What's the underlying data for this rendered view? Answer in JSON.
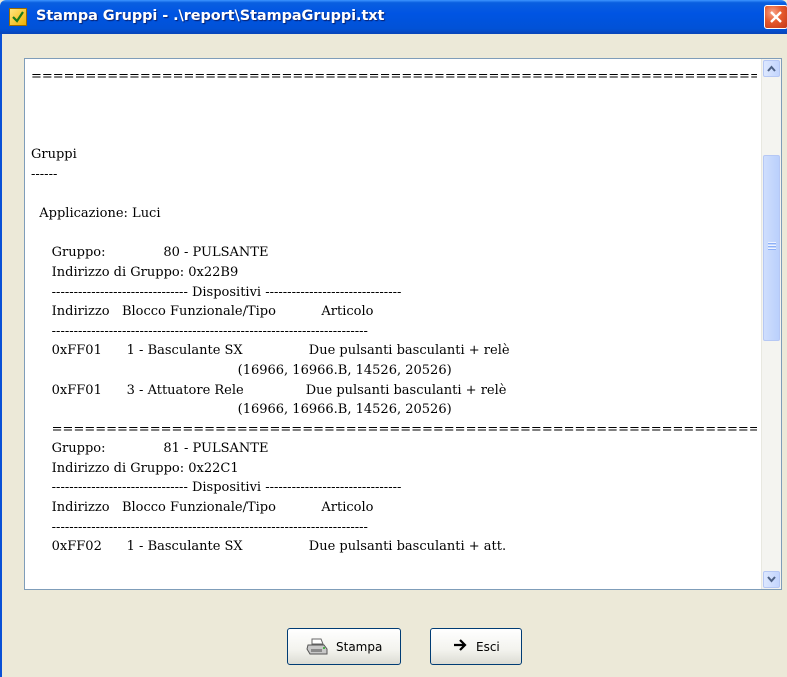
{
  "window": {
    "title": "Stampa Gruppi - .\\report\\StampaGruppi.txt"
  },
  "report": {
    "lines": [
      "================================================================================",
      "",
      "",
      "",
      "Gruppi",
      "------",
      "",
      "  Applicazione: Luci",
      "",
      "     Gruppo:              80 - PULSANTE",
      "     Indirizzo di Gruppo: 0x22B9",
      "     ------------------------------- Dispositivi -------------------------------",
      "     Indirizzo   Blocco Funzionale/Tipo           Articolo",
      "     ------------------------------------------------------------------------",
      "     0xFF01      1 - Basculante SX                Due pulsanti basculanti + relè",
      "                                                  (16966, 16966.B, 14526, 20526)",
      "     0xFF01      3 - Attuatore Rele               Due pulsanti basculanti + relè",
      "                                                  (16966, 16966.B, 14526, 20526)",
      "     ========================================================================",
      "     Gruppo:              81 - PULSANTE",
      "     Indirizzo di Gruppo: 0x22C1",
      "     ------------------------------- Dispositivi -------------------------------",
      "     Indirizzo   Blocco Funzionale/Tipo           Articolo",
      "     ------------------------------------------------------------------------",
      "     0xFF02      1 - Basculante SX                Due pulsanti basculanti + att."
    ]
  },
  "buttons": {
    "print_label": "Stampa",
    "exit_label": "Esci"
  },
  "icons": {
    "window": "app-icon",
    "close": "close-icon",
    "print": "printer-icon",
    "exit": "arrow-right-icon",
    "scroll_up": "chevron-up-icon",
    "scroll_down": "chevron-down-icon"
  }
}
